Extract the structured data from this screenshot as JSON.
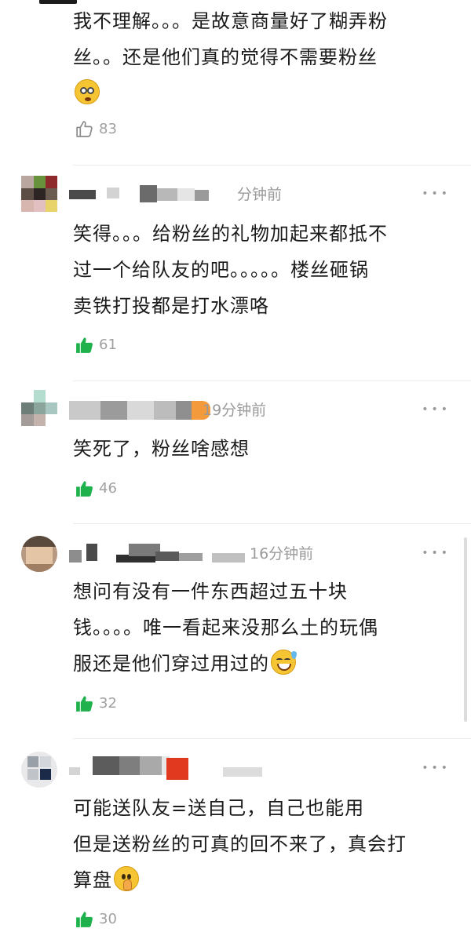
{
  "comments": [
    {
      "text_lines": [
        "我不理解。。。是故意商量好了糊弄粉",
        "丝。。还是他们真的觉得不需要粉丝"
      ],
      "emoji": "flushed-face-emoji",
      "likes": "83",
      "liked": false
    },
    {
      "time": "分钟前",
      "text_lines": [
        "笑得。。。给粉丝的礼物加起来都抵不",
        "过一个给队友的吧。。。。。楼丝砸锅",
        "卖铁打投都是打水漂咯"
      ],
      "likes": "61",
      "liked": true
    },
    {
      "time": "19分钟前",
      "text_lines": [
        "笑死了，粉丝啥感想"
      ],
      "likes": "46",
      "liked": true
    },
    {
      "time": "16分钟前",
      "text_lines": [
        "想问有没有一件东西超过五十块",
        "钱。。。。唯一看起来没那么土的玩偶",
        "服还是他们穿过用过的"
      ],
      "emoji": "grinning-sweat-emoji",
      "likes": "32",
      "liked": true
    },
    {
      "time": "",
      "text_lines": [
        "可能送队友=送自己，自己也能用",
        "但是送粉丝的可真的回不来了，真会打",
        "算盘"
      ],
      "emoji": "shushing-face-emoji",
      "likes": "30",
      "liked": true
    }
  ],
  "more_label": "•••",
  "colors": {
    "like_active": "#1fb14c",
    "like_inactive": "#9a9a9a",
    "muted_text": "#9a9a9a"
  }
}
